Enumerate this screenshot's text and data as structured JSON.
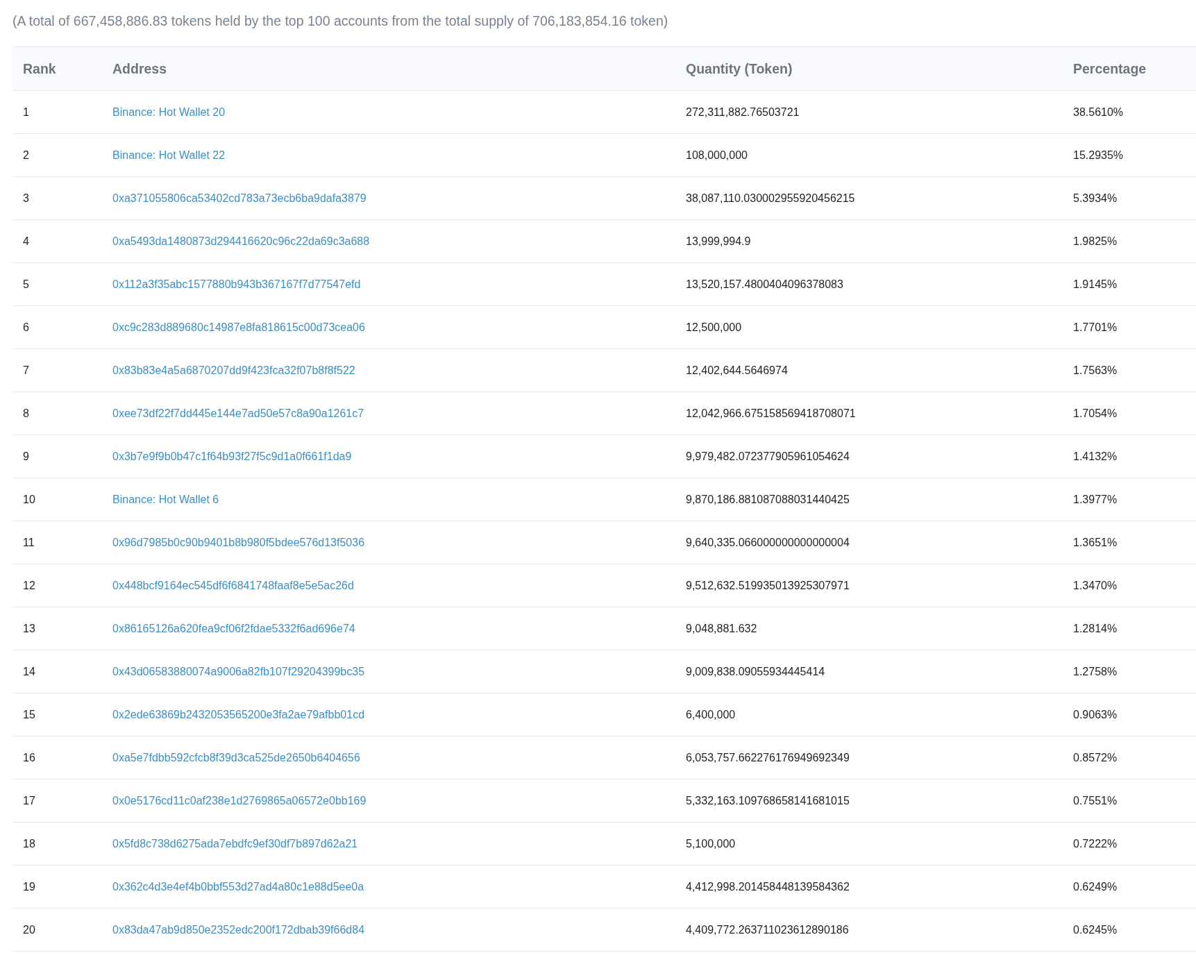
{
  "summary": "(A total of 667,458,886.83 tokens held by the top 100 accounts from the total supply of 706,183,854.16 token)",
  "table": {
    "columns": [
      "Rank",
      "Address",
      "Quantity (Token)",
      "Percentage"
    ],
    "rows": [
      {
        "rank": "1",
        "address": "Binance: Hot Wallet 20",
        "quantity": "272,311,882.76503721",
        "percentage": "38.5610%"
      },
      {
        "rank": "2",
        "address": "Binance: Hot Wallet 22",
        "quantity": "108,000,000",
        "percentage": "15.2935%"
      },
      {
        "rank": "3",
        "address": "0xa371055806ca53402cd783a73ecb6ba9dafa3879",
        "quantity": "38,087,110.030002955920456215",
        "percentage": "5.3934%"
      },
      {
        "rank": "4",
        "address": "0xa5493da1480873d294416620c96c22da69c3a688",
        "quantity": "13,999,994.9",
        "percentage": "1.9825%"
      },
      {
        "rank": "5",
        "address": "0x112a3f35abc1577880b943b367167f7d77547efd",
        "quantity": "13,520,157.4800404096378083",
        "percentage": "1.9145%"
      },
      {
        "rank": "6",
        "address": "0xc9c283d889680c14987e8fa818615c00d73cea06",
        "quantity": "12,500,000",
        "percentage": "1.7701%"
      },
      {
        "rank": "7",
        "address": "0x83b83e4a5a6870207dd9f423fca32f07b8f8f522",
        "quantity": "12,402,644.5646974",
        "percentage": "1.7563%"
      },
      {
        "rank": "8",
        "address": "0xee73df22f7dd445e144e7ad50e57c8a90a1261c7",
        "quantity": "12,042,966.675158569418708071",
        "percentage": "1.7054%"
      },
      {
        "rank": "9",
        "address": "0x3b7e9f9b0b47c1f64b93f27f5c9d1a0f661f1da9",
        "quantity": "9,979,482.072377905961054624",
        "percentage": "1.4132%"
      },
      {
        "rank": "10",
        "address": "Binance: Hot Wallet 6",
        "quantity": "9,870,186.881087088031440425",
        "percentage": "1.3977%"
      },
      {
        "rank": "11",
        "address": "0x96d7985b0c90b9401b8b980f5bdee576d13f5036",
        "quantity": "9,640,335.066000000000000004",
        "percentage": "1.3651%"
      },
      {
        "rank": "12",
        "address": "0x448bcf9164ec545df6f6841748faaf8e5e5ac26d",
        "quantity": "9,512,632.519935013925307971",
        "percentage": "1.3470%"
      },
      {
        "rank": "13",
        "address": "0x86165126a620fea9cf06f2fdae5332f6ad696e74",
        "quantity": "9,048,881.632",
        "percentage": "1.2814%"
      },
      {
        "rank": "14",
        "address": "0x43d06583880074a9006a82fb107f29204399bc35",
        "quantity": "9,009,838.09055934445414",
        "percentage": "1.2758%"
      },
      {
        "rank": "15",
        "address": "0x2ede63869b2432053565200e3fa2ae79afbb01cd",
        "quantity": "6,400,000",
        "percentage": "0.9063%"
      },
      {
        "rank": "16",
        "address": "0xa5e7fdbb592cfcb8f39d3ca525de2650b6404656",
        "quantity": "6,053,757.662276176949692349",
        "percentage": "0.8572%"
      },
      {
        "rank": "17",
        "address": "0x0e5176cd11c0af238e1d2769865a06572e0bb169",
        "quantity": "5,332,163.109768658141681015",
        "percentage": "0.7551%"
      },
      {
        "rank": "18",
        "address": "0x5fd8c738d6275ada7ebdfc9ef30df7b897d62a21",
        "quantity": "5,100,000",
        "percentage": "0.7222%"
      },
      {
        "rank": "19",
        "address": "0x362c4d3e4ef4b0bbf553d27ad4a80c1e88d5ee0a",
        "quantity": "4,412,998.201458448139584362",
        "percentage": "0.6249%"
      },
      {
        "rank": "20",
        "address": "0x83da47ab9d850e2352edc200f172dbab39f66d84",
        "quantity": "4,409,772.263711023612890186",
        "percentage": "0.6245%"
      }
    ]
  }
}
